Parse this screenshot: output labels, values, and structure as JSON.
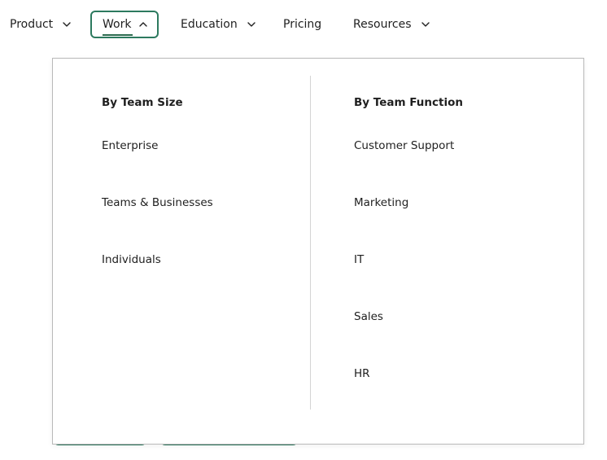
{
  "nav": {
    "items": [
      {
        "label": "Product",
        "has_chevron": true,
        "expanded": false
      },
      {
        "label": "Work",
        "has_chevron": true,
        "expanded": true
      },
      {
        "label": "Education",
        "has_chevron": true,
        "expanded": false
      },
      {
        "label": "Pricing",
        "has_chevron": false,
        "expanded": false
      },
      {
        "label": "Resources",
        "has_chevron": true,
        "expanded": false
      }
    ]
  },
  "dropdown": {
    "columns": [
      {
        "heading": "By Team Size",
        "links": [
          "Enterprise",
          "Teams & Businesses",
          "Individuals"
        ]
      },
      {
        "heading": "By Team Function",
        "links": [
          "Customer Support",
          "Marketing",
          "IT",
          "Sales",
          "HR"
        ]
      }
    ]
  },
  "colors": {
    "accent": "#2d7a5f",
    "text": "#1f1f1f",
    "divider": "#d4d4d4",
    "border": "#b9b9b9"
  },
  "icons": {
    "collapsed": "chevron-down-icon",
    "expanded": "chevron-up-icon"
  }
}
